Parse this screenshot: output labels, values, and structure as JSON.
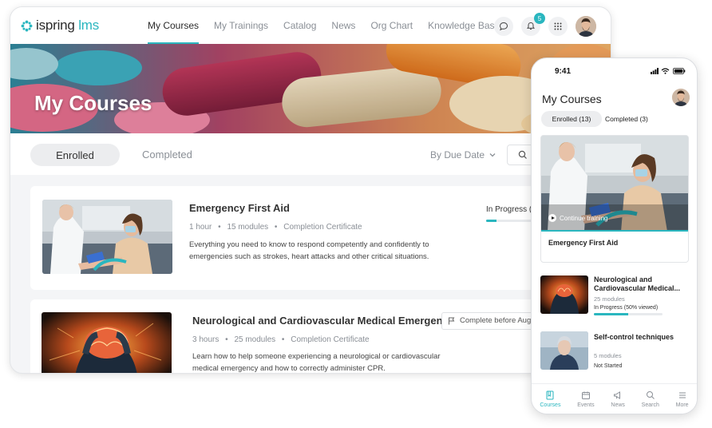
{
  "brand": {
    "logo_word": "ispring",
    "logo_suffix": " lms",
    "accent": "#2ab6bf"
  },
  "nav": {
    "links": [
      "My Courses",
      "My Trainings",
      "Catalog",
      "News",
      "Org Chart",
      "Knowledge Base"
    ],
    "active": "My Courses",
    "notification_count": "5",
    "icons": [
      "chat-icon",
      "bell-icon",
      "apps-grid-icon",
      "user-avatar"
    ]
  },
  "hero": {
    "title": "My Courses"
  },
  "filters": {
    "tab_enrolled": "Enrolled",
    "tab_completed": "Completed",
    "sort_label": "By Due Date"
  },
  "courses": [
    {
      "title": "Emergency First Aid",
      "duration": "1 hour",
      "modules": "15 modules",
      "certificate": "Completion Certificate",
      "description": "Everything you need to know to respond competently and confidently to emergencies such as strokes, heart attacks and other critical situations.",
      "status": "In Progress (",
      "progress": 0.1
    },
    {
      "title": "Neurological and Cardiovascular Medical Emergencies",
      "duration": "3 hours",
      "modules": "25 modules",
      "certificate": "Completion Certificate",
      "description": "Learn how to help someone experiencing a neurological or cardiovascular medical emergency and how to correctly administer CPR.",
      "due": "Complete before Aug"
    }
  ],
  "phone": {
    "time": "9:41",
    "title": "My Courses",
    "tab_enrolled": "Enrolled (13)",
    "tab_completed": "Completed (3)",
    "featured": {
      "continue_label": "Continue training",
      "title": "Emergency First Aid"
    },
    "items": [
      {
        "title": "Neurological and Cardiovascular Medical...",
        "modules": "25 modules",
        "status": "In Progress (50% viewed)",
        "progress": 0.5
      },
      {
        "title": "Self-control techniques",
        "modules": "5 modules",
        "status": "Not Started"
      }
    ],
    "bottom_nav": [
      "Courses",
      "Events",
      "News",
      "Search",
      "More"
    ],
    "bottom_nav_active": "Courses"
  }
}
